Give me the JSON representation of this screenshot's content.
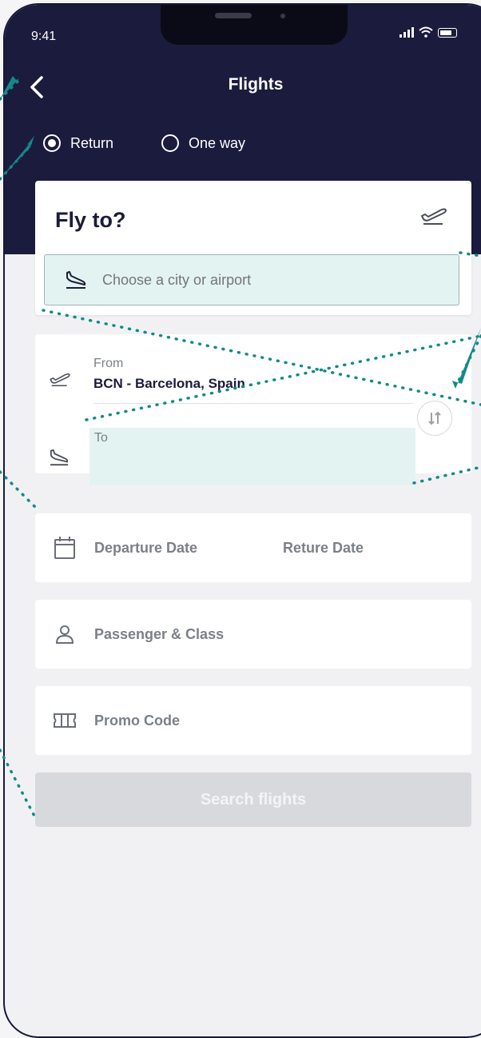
{
  "status_bar": {
    "time": "9:41"
  },
  "header": {
    "title": "Flights"
  },
  "trip_type": {
    "options": [
      {
        "label": "Return",
        "selected": true
      },
      {
        "label": "One way",
        "selected": false
      }
    ]
  },
  "fly_to": {
    "title": "Fly to?",
    "search_placeholder": "Choose a city or airport"
  },
  "route": {
    "from_label": "From",
    "from_value": "BCN - Barcelona, Spain",
    "to_label": "To",
    "to_value": ""
  },
  "dates": {
    "departure_label": "Departure Date",
    "return_label": "Reture Date"
  },
  "passenger": {
    "label": "Passenger & Class"
  },
  "promo": {
    "label": "Promo Code"
  },
  "actions": {
    "search_label": "Search flights"
  },
  "colors": {
    "header_bg": "#1b1b3d",
    "accent": "#1a9a9c",
    "highlight": "#e3f3f2",
    "disabled": "#d8d9dc"
  },
  "icons": [
    "back-arrow-icon",
    "signal-icon",
    "wifi-icon",
    "battery-icon",
    "takeoff-icon",
    "landing-icon",
    "swap-icon",
    "calendar-icon",
    "person-icon",
    "ticket-icon"
  ]
}
